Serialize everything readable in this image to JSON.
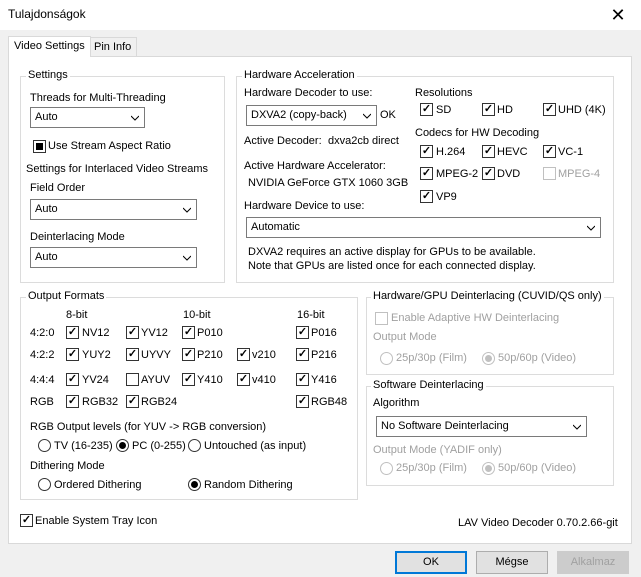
{
  "window": {
    "title": "Tulajdonságok",
    "close": "✕"
  },
  "tabs": [
    {
      "label": "Video Settings"
    },
    {
      "label": "Pin Info"
    }
  ],
  "settings": {
    "title": "Settings",
    "threads_label": "Threads for Multi-Threading",
    "threads_value": "Auto",
    "stream_aspect": "Use Stream Aspect Ratio",
    "interlaced_label": "Settings for Interlaced Video Streams",
    "field_order_label": "Field Order",
    "field_order_value": "Auto",
    "deint_mode_label": "Deinterlacing Mode",
    "deint_mode_value": "Auto"
  },
  "hwaccel": {
    "title": "Hardware Acceleration",
    "decoder_label": "Hardware Decoder to use:",
    "decoder_value": "DXVA2 (copy-back)",
    "decoder_status": "OK",
    "active_decoder_label": "Active Decoder:",
    "active_decoder_value": "dxva2cb direct",
    "active_accel_label": "Active Hardware Accelerator:",
    "active_accel_value": "NVIDIA GeForce GTX 1060 3GB",
    "device_label": "Hardware Device to use:",
    "device_value": "Automatic",
    "note1": "DXVA2 requires an active display for GPUs to be available.",
    "note2": "Note that GPUs are listed once for each connected display.",
    "resolutions_label": "Resolutions",
    "res_sd": "SD",
    "res_hd": "HD",
    "res_uhd": "UHD (4K)",
    "codecs_label": "Codecs for HW Decoding",
    "codec_h264": "H.264",
    "codec_hevc": "HEVC",
    "codec_vc1": "VC-1",
    "codec_mpeg2": "MPEG-2",
    "codec_dvd": "DVD",
    "codec_mpeg4": "MPEG-4",
    "codec_vp9": "VP9"
  },
  "output": {
    "title": "Output Formats",
    "h_8bit": "8-bit",
    "h_10bit": "10-bit",
    "h_16bit": "16-bit",
    "r420": "4:2:0",
    "r422": "4:2:2",
    "r444": "4:4:4",
    "rrgb": "RGB",
    "nv12": "NV12",
    "yv12": "YV12",
    "p010": "P010",
    "p016": "P016",
    "yuy2": "YUY2",
    "uyvy": "UYVY",
    "p210": "P210",
    "v210": "v210",
    "p216": "P216",
    "yv24": "YV24",
    "ayuv": "AYUV",
    "y410": "Y410",
    "v410": "v410",
    "y416": "Y416",
    "rgb32": "RGB32",
    "rgb24": "RGB24",
    "rgb48": "RGB48",
    "levels_label": "RGB Output levels (for YUV -> RGB conversion)",
    "lv_tv": "TV (16-235)",
    "lv_pc": "PC (0-255)",
    "lv_untouched": "Untouched (as input)",
    "dither_label": "Dithering Mode",
    "dither_ordered": "Ordered Dithering",
    "dither_random": "Random Dithering"
  },
  "hwdeint": {
    "title": "Hardware/GPU Deinterlacing (CUVID/QS only)",
    "enable": "Enable Adaptive HW Deinterlacing",
    "output_mode": "Output Mode",
    "opt_film": "25p/30p (Film)",
    "opt_video": "50p/60p (Video)"
  },
  "swdeint": {
    "title": "Software Deinterlacing",
    "algorithm_label": "Algorithm",
    "algorithm_value": "No Software Deinterlacing",
    "output_mode": "Output Mode (YADIF only)",
    "opt_film": "25p/30p (Film)",
    "opt_video": "50p/60p (Video)"
  },
  "footer": {
    "tray": "Enable System Tray Icon",
    "version": "LAV Video Decoder 0.70.2.66-git"
  },
  "buttons": {
    "ok": "OK",
    "cancel": "Mégse",
    "apply": "Alkalmaz"
  },
  "colors": {
    "accent": "#0078d7",
    "disabled": "#a0a0a0",
    "group_border": "#dcdcdc"
  }
}
